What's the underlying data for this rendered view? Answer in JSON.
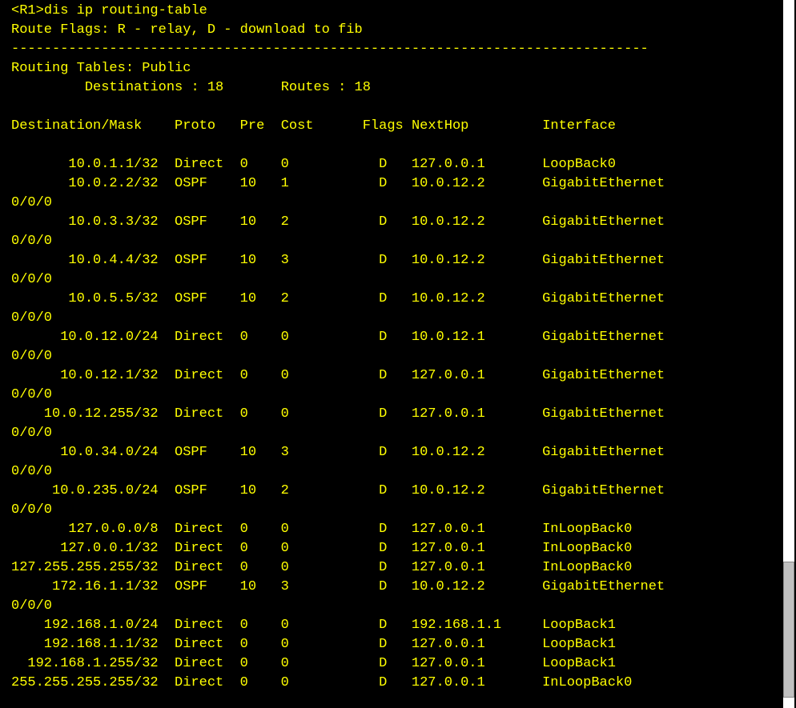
{
  "prompt": {
    "prefix": "<R1>",
    "command": "dis ip routing-table"
  },
  "flags_line": "Route Flags: R - relay, D - download to fib",
  "separator": "------------------------------------------------------------------------------",
  "table_header": "Routing Tables: Public",
  "summary": {
    "dest_label": "Destinations :",
    "dest_value": "18",
    "routes_label": "Routes :",
    "routes_value": "18"
  },
  "columns": {
    "dest": "Destination/Mask",
    "proto": "Proto",
    "pre": "Pre",
    "cost": "Cost",
    "flags": "Flags",
    "nexthop": "NextHop",
    "intf": "Interface"
  },
  "routes": [
    {
      "dest": "10.0.1.1/32",
      "proto": "Direct",
      "pre": "0",
      "cost": "0",
      "flags": "D",
      "nexthop": "127.0.0.1",
      "intf": "LoopBack0",
      "wrap": false
    },
    {
      "dest": "10.0.2.2/32",
      "proto": "OSPF",
      "pre": "10",
      "cost": "1",
      "flags": "D",
      "nexthop": "10.0.12.2",
      "intf": "GigabitEthernet",
      "wrap": true,
      "cont": "0/0/0"
    },
    {
      "dest": "10.0.3.3/32",
      "proto": "OSPF",
      "pre": "10",
      "cost": "2",
      "flags": "D",
      "nexthop": "10.0.12.2",
      "intf": "GigabitEthernet",
      "wrap": true,
      "cont": "0/0/0"
    },
    {
      "dest": "10.0.4.4/32",
      "proto": "OSPF",
      "pre": "10",
      "cost": "3",
      "flags": "D",
      "nexthop": "10.0.12.2",
      "intf": "GigabitEthernet",
      "wrap": true,
      "cont": "0/0/0"
    },
    {
      "dest": "10.0.5.5/32",
      "proto": "OSPF",
      "pre": "10",
      "cost": "2",
      "flags": "D",
      "nexthop": "10.0.12.2",
      "intf": "GigabitEthernet",
      "wrap": true,
      "cont": "0/0/0"
    },
    {
      "dest": "10.0.12.0/24",
      "proto": "Direct",
      "pre": "0",
      "cost": "0",
      "flags": "D",
      "nexthop": "10.0.12.1",
      "intf": "GigabitEthernet",
      "wrap": true,
      "cont": "0/0/0"
    },
    {
      "dest": "10.0.12.1/32",
      "proto": "Direct",
      "pre": "0",
      "cost": "0",
      "flags": "D",
      "nexthop": "127.0.0.1",
      "intf": "GigabitEthernet",
      "wrap": true,
      "cont": "0/0/0"
    },
    {
      "dest": "10.0.12.255/32",
      "proto": "Direct",
      "pre": "0",
      "cost": "0",
      "flags": "D",
      "nexthop": "127.0.0.1",
      "intf": "GigabitEthernet",
      "wrap": true,
      "cont": "0/0/0"
    },
    {
      "dest": "10.0.34.0/24",
      "proto": "OSPF",
      "pre": "10",
      "cost": "3",
      "flags": "D",
      "nexthop": "10.0.12.2",
      "intf": "GigabitEthernet",
      "wrap": true,
      "cont": "0/0/0"
    },
    {
      "dest": "10.0.235.0/24",
      "proto": "OSPF",
      "pre": "10",
      "cost": "2",
      "flags": "D",
      "nexthop": "10.0.12.2",
      "intf": "GigabitEthernet",
      "wrap": true,
      "cont": "0/0/0"
    },
    {
      "dest": "127.0.0.0/8",
      "proto": "Direct",
      "pre": "0",
      "cost": "0",
      "flags": "D",
      "nexthop": "127.0.0.1",
      "intf": "InLoopBack0",
      "wrap": false
    },
    {
      "dest": "127.0.0.1/32",
      "proto": "Direct",
      "pre": "0",
      "cost": "0",
      "flags": "D",
      "nexthop": "127.0.0.1",
      "intf": "InLoopBack0",
      "wrap": false
    },
    {
      "dest": "127.255.255.255/32",
      "proto": "Direct",
      "pre": "0",
      "cost": "0",
      "flags": "D",
      "nexthop": "127.0.0.1",
      "intf": "InLoopBack0",
      "wrap": false
    },
    {
      "dest": "172.16.1.1/32",
      "proto": "OSPF",
      "pre": "10",
      "cost": "3",
      "flags": "D",
      "nexthop": "10.0.12.2",
      "intf": "GigabitEthernet",
      "wrap": true,
      "cont": "0/0/0"
    },
    {
      "dest": "192.168.1.0/24",
      "proto": "Direct",
      "pre": "0",
      "cost": "0",
      "flags": "D",
      "nexthop": "192.168.1.1",
      "intf": "LoopBack1",
      "wrap": false
    },
    {
      "dest": "192.168.1.1/32",
      "proto": "Direct",
      "pre": "0",
      "cost": "0",
      "flags": "D",
      "nexthop": "127.0.0.1",
      "intf": "LoopBack1",
      "wrap": false
    },
    {
      "dest": "192.168.1.255/32",
      "proto": "Direct",
      "pre": "0",
      "cost": "0",
      "flags": "D",
      "nexthop": "127.0.0.1",
      "intf": "LoopBack1",
      "wrap": false
    },
    {
      "dest": "255.255.255.255/32",
      "proto": "Direct",
      "pre": "0",
      "cost": "0",
      "flags": "D",
      "nexthop": "127.0.0.1",
      "intf": "InLoopBack0",
      "wrap": false
    }
  ]
}
